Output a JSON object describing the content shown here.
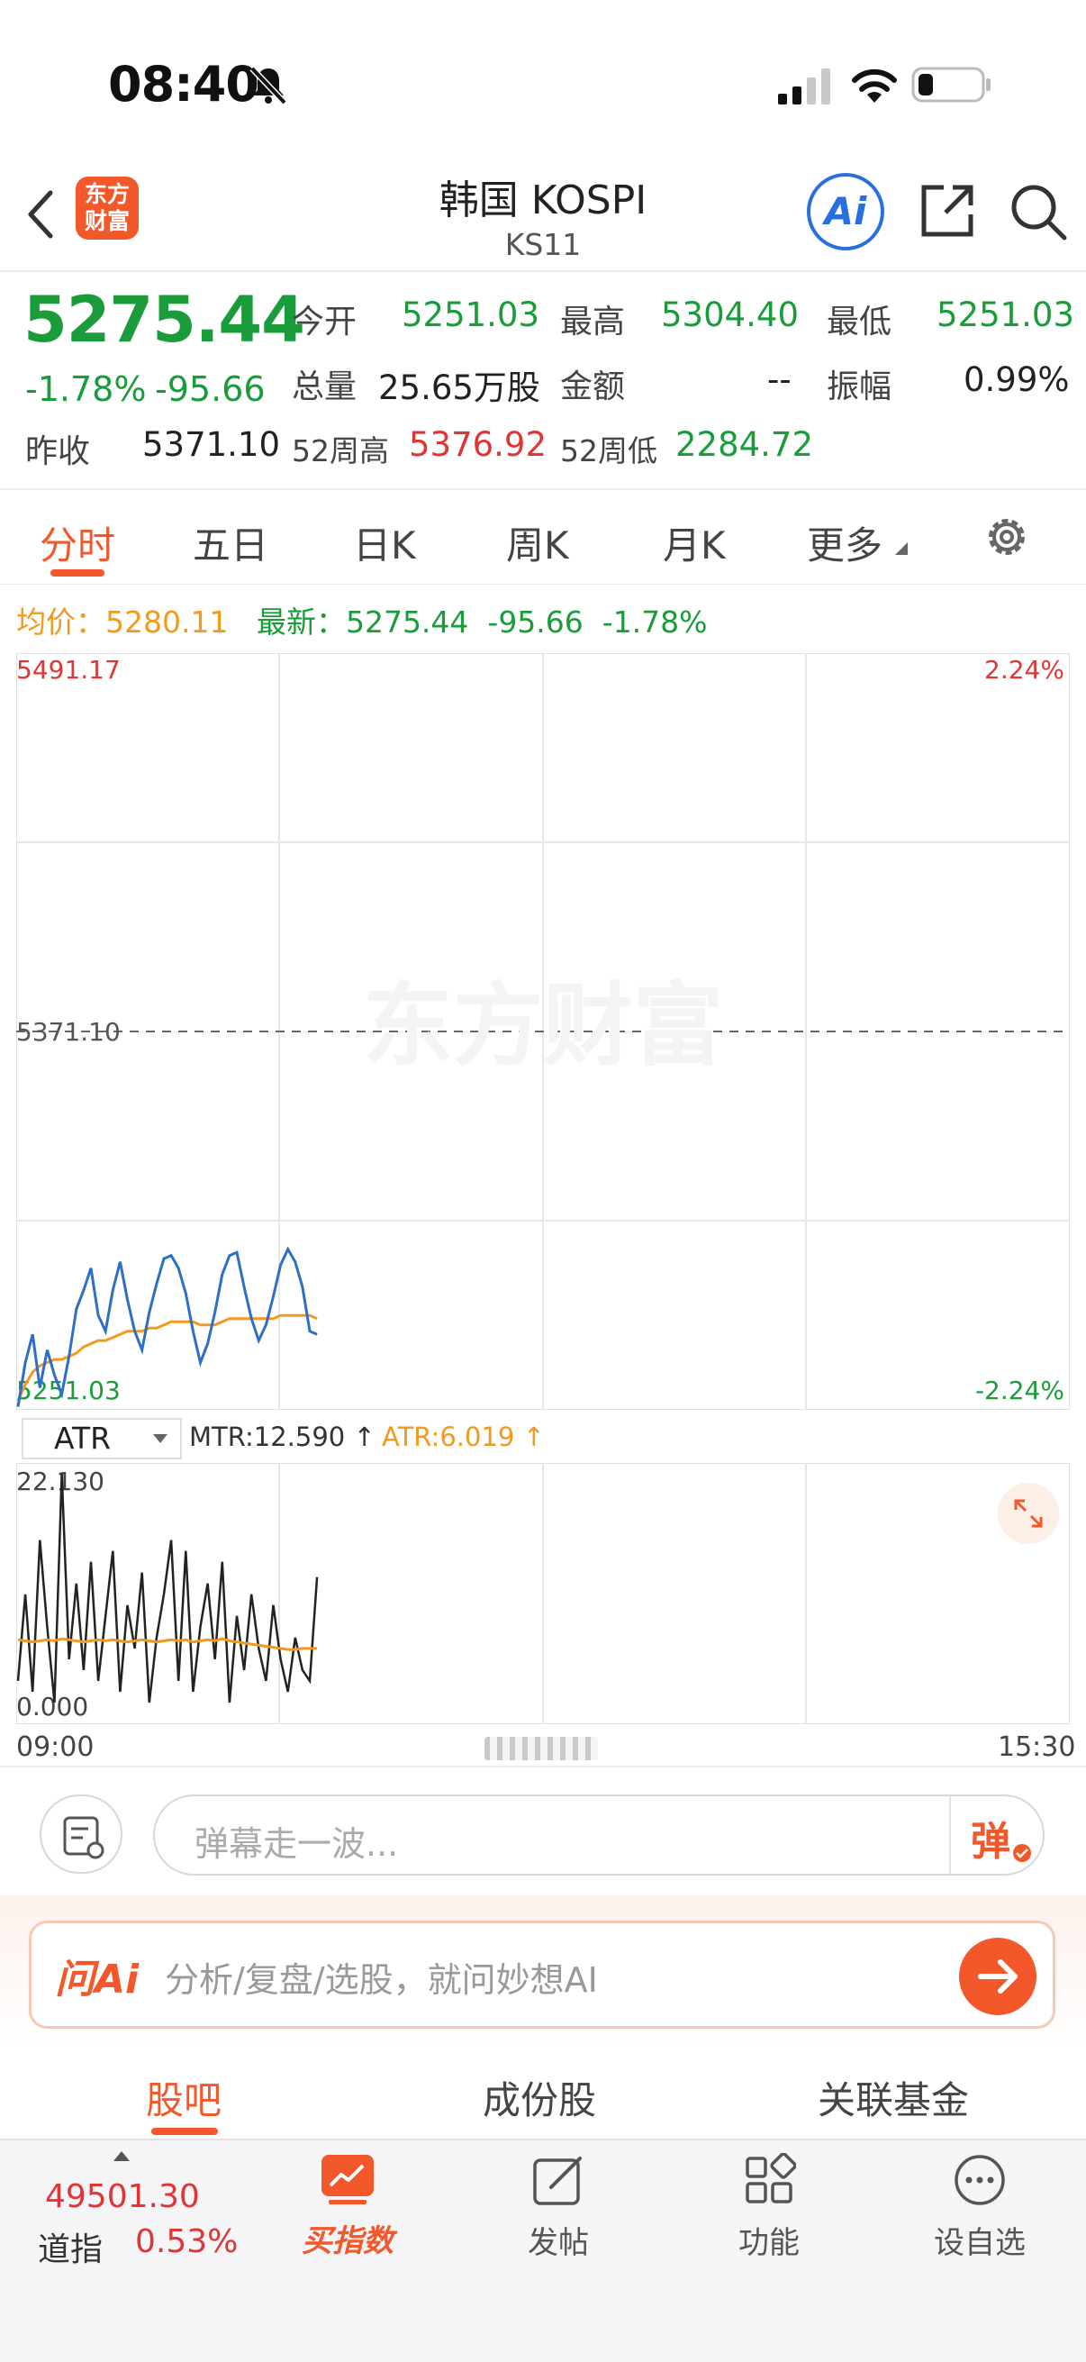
{
  "status": {
    "time": "08:40"
  },
  "header": {
    "logo_text": "东方财富",
    "title": "韩国 KOSPI",
    "subtitle": "KS11",
    "ai_label": "Ai"
  },
  "quote": {
    "price": "5275.44",
    "change_pct": "-1.78%",
    "change": "-95.66",
    "open_label": "今开",
    "open": "5251.03",
    "high_label": "最高",
    "high": "5304.40",
    "low_label": "最低",
    "low": "5251.03",
    "volume_label": "总量",
    "volume": "25.65万股",
    "amount_label": "金额",
    "amount": "--",
    "amplitude_label": "振幅",
    "amplitude": "0.99%",
    "prev_close_label": "昨收",
    "prev_close": "5371.10",
    "w52_high_label": "52周高",
    "w52_high": "5376.92",
    "w52_low_label": "52周低",
    "w52_low": "2284.72"
  },
  "tabs": [
    {
      "label": "分时"
    },
    {
      "label": "五日"
    },
    {
      "label": "日K"
    },
    {
      "label": "周K"
    },
    {
      "label": "月K"
    },
    {
      "label": "更多"
    }
  ],
  "info": {
    "avg_label": "均价：",
    "avg": "5280.11",
    "latest_label": "最新：",
    "latest": "5275.44",
    "latest_change": "-95.66",
    "latest_pct": "-1.78%"
  },
  "colors": {
    "accent": "#f2582a",
    "up": "#e03535",
    "down": "#1a9c3a",
    "price_line": "#2d6fc7",
    "avg_line": "#f29a1f"
  },
  "chart_data": {
    "type": "line",
    "top_price": "5491.17",
    "top_pct": "2.24%",
    "mid_price": "5371.10",
    "bottom_price": "5251.03",
    "bottom_pct": "-2.24%",
    "ylim": [
      5251.03,
      5491.17
    ],
    "watermark": "东方财富",
    "time_start": "09:00",
    "time_end": "15:30",
    "session_points": 390,
    "series": [
      {
        "values": [
          5252,
          5266,
          5275,
          5258,
          5270,
          5262,
          5256,
          5268,
          5283,
          5289,
          5296,
          5281,
          5276,
          5289,
          5298,
          5286,
          5276,
          5270,
          5282,
          5291,
          5299,
          5300,
          5296,
          5288,
          5276,
          5266,
          5272,
          5282,
          5294,
          5300,
          5301,
          5290,
          5280,
          5273,
          5278,
          5287,
          5297,
          5302,
          5298,
          5290,
          5276,
          5275
        ]
      },
      {
        "values": [
          5254,
          5259,
          5263,
          5265,
          5266,
          5267,
          5267,
          5268,
          5269,
          5271,
          5272,
          5273,
          5273,
          5274,
          5275,
          5276,
          5276,
          5276,
          5277,
          5277,
          5278,
          5279,
          5279,
          5279,
          5279,
          5278,
          5278,
          5278,
          5279,
          5280,
          5280,
          5280,
          5280,
          5280,
          5280,
          5280,
          5281,
          5281,
          5281,
          5281,
          5281,
          5280
        ]
      }
    ]
  },
  "atr": {
    "indicator": "ATR",
    "mtr_label": "MTR:12.590 ↑",
    "atr_label": "ATR:6.019 ↑",
    "ymax": "22.130",
    "ymin": "0.000",
    "ylim": [
      0,
      22.13
    ],
    "mtr_values": [
      3,
      11,
      2,
      16,
      8,
      1,
      22.13,
      5,
      12,
      4,
      14,
      3,
      9,
      15,
      2,
      10,
      6,
      13,
      1,
      7,
      11,
      16,
      3,
      15,
      2,
      8,
      12,
      5,
      14,
      1,
      9,
      4,
      11,
      6,
      3,
      10,
      5,
      2,
      7,
      4,
      3,
      12.59
    ],
    "atr_values": [
      6.8,
      6.7,
      6.6,
      6.7,
      6.8,
      6.7,
      6.9,
      6.8,
      6.7,
      6.6,
      6.7,
      6.8,
      6.7,
      6.8,
      6.7,
      6.6,
      6.7,
      6.8,
      6.7,
      6.6,
      6.7,
      6.8,
      6.7,
      6.8,
      6.6,
      6.7,
      6.8,
      6.7,
      6.9,
      6.7,
      6.6,
      6.5,
      6.4,
      6.3,
      6.2,
      6.1,
      6.0,
      5.9,
      5.9,
      6.0,
      6.0,
      6.019
    ]
  },
  "danmaku": {
    "placeholder": "弹幕走一波...",
    "icon_text": "弹"
  },
  "ask_ai": {
    "logo": "问Ai",
    "placeholder": "分析/复盘/选股，就问妙想AI"
  },
  "subtabs": [
    {
      "label": "股吧"
    },
    {
      "label": "成份股"
    },
    {
      "label": "关联基金"
    }
  ],
  "bottom": {
    "dow_value": "49501.30",
    "dow_name": "道指",
    "dow_pct": "0.53%",
    "items": [
      {
        "label": "买指数"
      },
      {
        "label": "发帖"
      },
      {
        "label": "功能"
      },
      {
        "label": "设自选"
      }
    ]
  }
}
